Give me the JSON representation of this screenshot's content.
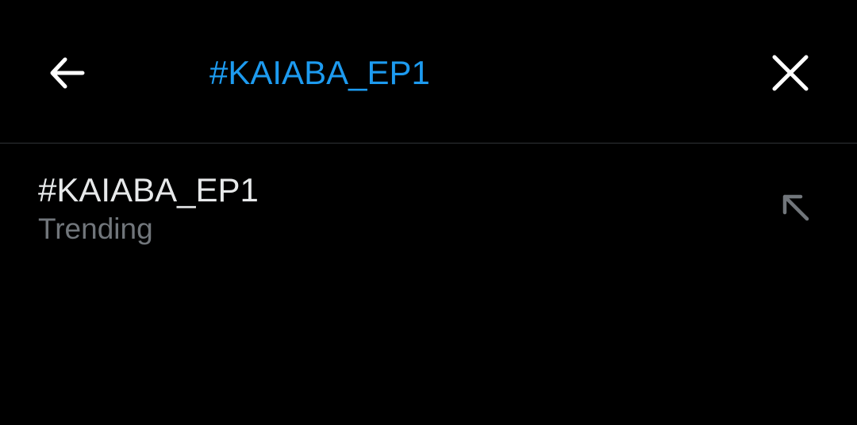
{
  "search": {
    "value": "#KAIABA_EP1",
    "back_icon": "arrow-left-icon",
    "clear_icon": "close-icon"
  },
  "suggestions": [
    {
      "title": "#KAIABA_EP1",
      "subtitle": "Trending",
      "fill_icon": "arrow-up-left-icon"
    }
  ],
  "colors": {
    "background": "#000000",
    "accent": "#1d9bf0",
    "primary_text": "#e7e9ea",
    "secondary_text": "#71767b",
    "divider": "#2f3336"
  }
}
